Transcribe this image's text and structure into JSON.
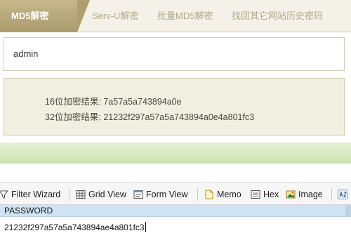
{
  "web": {
    "tabs": [
      {
        "label": "MD5解密",
        "active": true
      },
      {
        "label": "Serv-U解密",
        "active": false
      },
      {
        "label": "批量MD5解密",
        "active": false
      },
      {
        "label": "找回其它网站历史密码",
        "active": false
      }
    ],
    "input_value": "admin",
    "results": {
      "line16": "16位加密结果: 7a57a5a743894a0e",
      "line32": "32位加密结果: 21232f297a57a5a743894a0e4a801fc3"
    }
  },
  "app": {
    "toolbar": {
      "filter_wizard": "Filter Wizard",
      "grid_view": "Grid View",
      "form_view": "Form View",
      "memo": "Memo",
      "hex": "Hex",
      "image": "Image"
    },
    "grid": {
      "column_header": "PASSWORD",
      "cell_value": "21232f297a57a5a743894ae4a801fc3"
    }
  },
  "colors": {
    "active_tab": "#ae9e70",
    "result_bg": "#f1eee2",
    "grid_header": "#cfe3f4"
  }
}
